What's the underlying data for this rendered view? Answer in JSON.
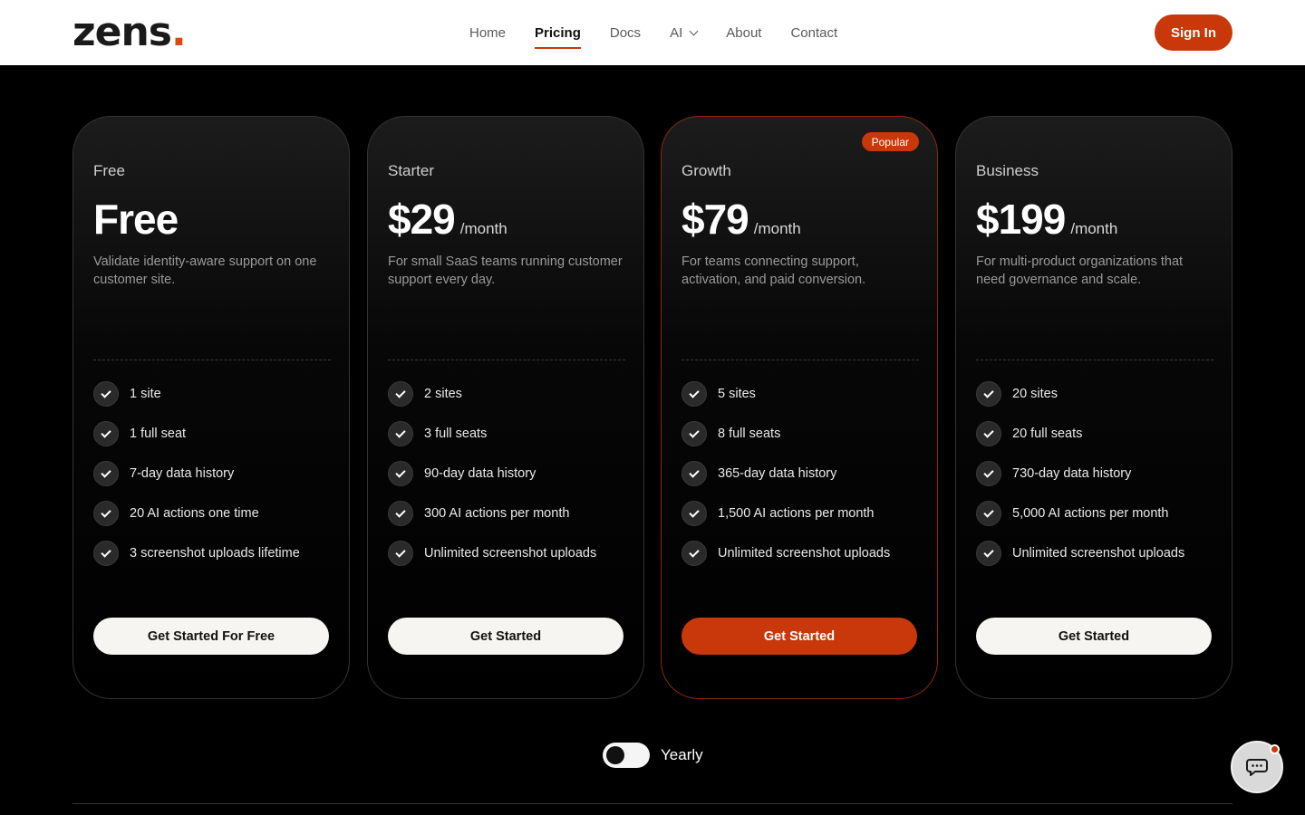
{
  "header": {
    "logo_text": "zens",
    "logo_dot": ".",
    "nav": [
      {
        "label": "Home"
      },
      {
        "label": "Pricing",
        "active": true
      },
      {
        "label": "Docs"
      },
      {
        "label": "AI"
      },
      {
        "label": "About"
      },
      {
        "label": "Contact"
      }
    ],
    "sign_in": "Sign In"
  },
  "plans": [
    {
      "label": "Free",
      "price": "Free",
      "per": "",
      "description": "Validate identity-aware support on one customer site.",
      "features": [
        "1 site",
        "1 full seat",
        "7-day data history",
        "20 AI actions one time",
        "3 screenshot uploads lifetime"
      ],
      "cta": "Get Started For Free"
    },
    {
      "label": "Starter",
      "price": "$29",
      "per": "/month",
      "description": "For small SaaS teams running customer support every day.",
      "features": [
        "2 sites",
        "3 full seats",
        "90-day data history",
        "300 AI actions per month",
        "Unlimited screenshot uploads"
      ],
      "cta": "Get Started"
    },
    {
      "label": "Growth",
      "price": "$79",
      "per": "/month",
      "badge": "Popular",
      "description": "For teams connecting support, activation, and paid conversion.",
      "features": [
        "5 sites",
        "8 full seats",
        "365-day data history",
        "1,500 AI actions per month",
        "Unlimited screenshot uploads"
      ],
      "cta": "Get Started"
    },
    {
      "label": "Business",
      "price": "$199",
      "per": "/month",
      "description": "For multi-product organizations that need governance and scale.",
      "features": [
        "20 sites",
        "20 full seats",
        "730-day data history",
        "5,000 AI actions per month",
        "Unlimited screenshot uploads"
      ],
      "cta": "Get Started"
    }
  ],
  "billing": {
    "toggle_label": "Yearly",
    "yearly_enabled": false
  },
  "colors": {
    "accent": "#c8380a",
    "background": "#000000"
  },
  "icons": {
    "feature": "check-icon",
    "chat": "chat-bubble-icon",
    "nav_ai": "chevron-down-icon"
  }
}
